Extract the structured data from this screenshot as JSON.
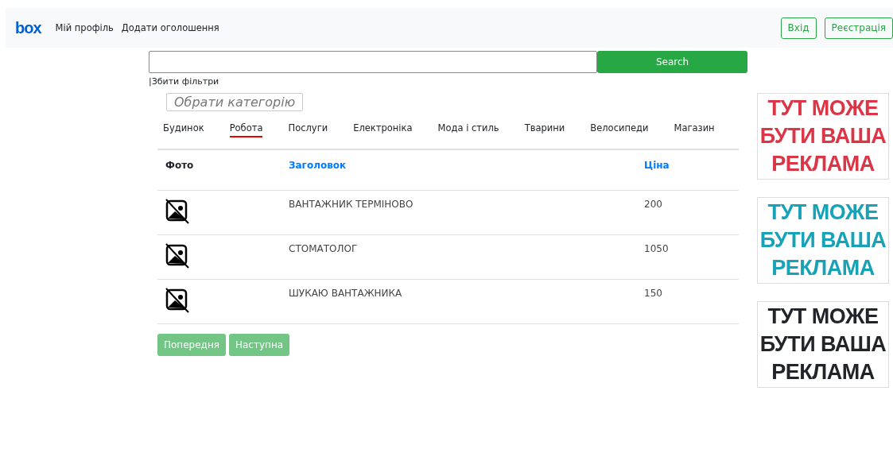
{
  "navbar": {
    "logo": "box",
    "links": [
      "Мій профіль",
      "Додати оголошення"
    ],
    "buttons": [
      "Вхід",
      "Реєстрація"
    ]
  },
  "search": {
    "button": "Search",
    "reset": "|Збити фільтри"
  },
  "category_button": "Обрати категорію",
  "tabs": [
    {
      "label": "Будинок",
      "selected": false
    },
    {
      "label": "Робота",
      "selected": true
    },
    {
      "label": "Послуги",
      "selected": false
    },
    {
      "label": "Електроніка",
      "selected": false
    },
    {
      "label": "Мода і стиль",
      "selected": false
    },
    {
      "label": "Тварини",
      "selected": false
    },
    {
      "label": "Велосипеди",
      "selected": false
    },
    {
      "label": "Магазин",
      "selected": false
    }
  ],
  "table": {
    "columns": [
      {
        "label": "Фото",
        "sortable": false
      },
      {
        "label": "Заголовок",
        "sortable": true
      },
      {
        "label": "Ціна",
        "sortable": true
      }
    ],
    "rows": [
      {
        "title": "ВАНТАЖНИК ТЕРМІНОВО",
        "price": "200"
      },
      {
        "title": "СТОМАТОЛОГ",
        "price": "1050"
      },
      {
        "title": "ШУКАЮ ВАНТАЖНИКА",
        "price": "150"
      }
    ]
  },
  "pagination": [
    {
      "label": "Попередня",
      "disabled": true
    },
    {
      "label": "Наступна",
      "disabled": true
    }
  ],
  "ads": [
    {
      "text": "ТУТ МОЖЕ БУТИ ВАША РЕКЛАМА",
      "color": "#dc3545"
    },
    {
      "text": "ТУТ МОЖЕ БУТИ ВАША РЕКЛАМА",
      "color": "#17a2b8"
    },
    {
      "text": "ТУТ МОЖЕ БУТИ ВАША РЕКЛАМА",
      "color": "#212529"
    }
  ]
}
